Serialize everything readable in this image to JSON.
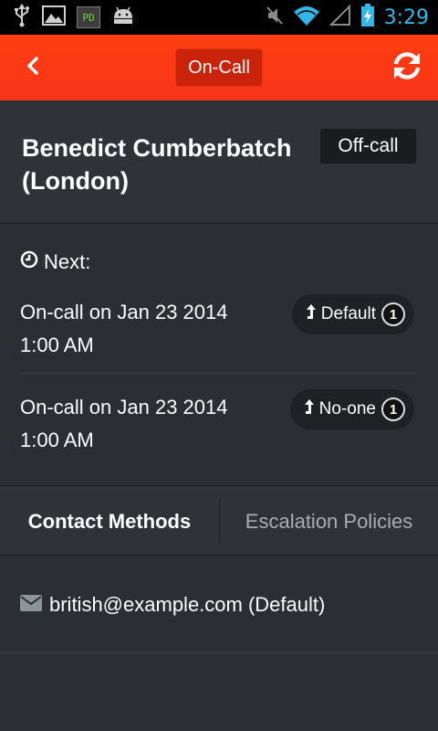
{
  "status_bar": {
    "time": "3:29",
    "left_icons": [
      "usb-icon",
      "image-icon",
      "pd-app-icon",
      "android-icon"
    ],
    "right_icons": [
      "mute-icon",
      "wifi-icon",
      "signal-icon",
      "battery-charging-icon"
    ],
    "pd_label": "PD",
    "colors": {
      "time": "#33b5e5",
      "battery": "#33b5e5"
    }
  },
  "header": {
    "title": "On-Call",
    "back_icon": "chevron-left-icon",
    "refresh_icon": "refresh-icon",
    "colors": {
      "bar": "#f7341a",
      "title_pill": "#c9240b"
    }
  },
  "user": {
    "name": "Benedict Cumberbatch (London)",
    "status": "Off-call"
  },
  "next": {
    "label": "Next:",
    "icon": "clock-icon",
    "schedules": [
      {
        "when": "On-call on Jan 23 2014 1:00 AM",
        "policy": "Default",
        "level": "1"
      },
      {
        "when": "On-call on Jan 23 2014 1:00 AM",
        "policy": "No-one",
        "level": "1"
      }
    ]
  },
  "tabs": [
    {
      "label": "Contact Methods",
      "active": true
    },
    {
      "label": "Escalation Policies",
      "active": false
    }
  ],
  "contact_methods": [
    {
      "icon": "envelope-icon",
      "value": "british@example.com (Default)"
    }
  ]
}
